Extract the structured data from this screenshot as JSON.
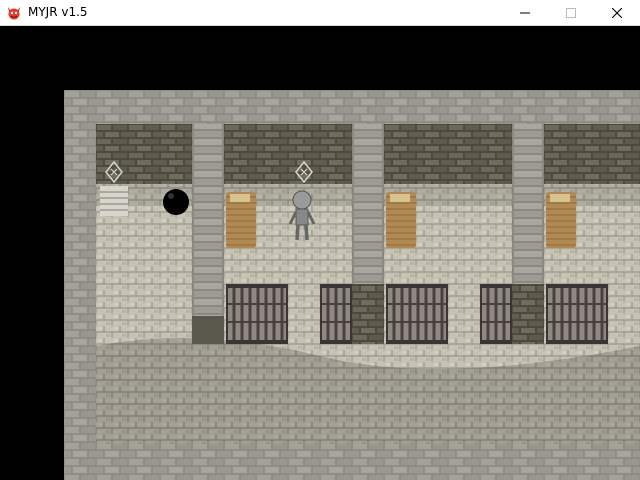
{
  "window": {
    "title": "MYJR v1.5",
    "icon": "app-devil-icon",
    "controls": [
      "minimize-icon",
      "maximize-icon",
      "close-icon"
    ]
  },
  "scene": {
    "type": "rpg-dungeon-map",
    "description_items": [
      "stone-cells",
      "iron-bars",
      "straw-beds",
      "wall-lamps",
      "player-sprite",
      "black-orb",
      "stairs"
    ],
    "colors": {
      "background": "#000000",
      "wall_top": "#8c8c84",
      "floor": "#c8c5b8",
      "bars": "#4a3f42"
    }
  }
}
